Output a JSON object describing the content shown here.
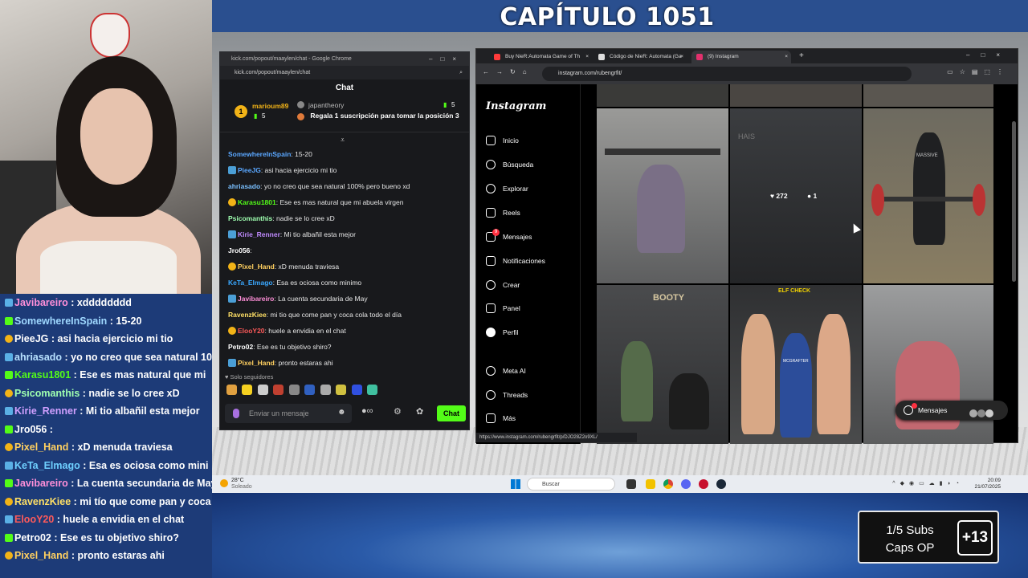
{
  "stream": {
    "chapter_title": "CAPÍTULO 1051",
    "chat_lines": [
      {
        "user": "Javibareiro",
        "text": " : xdddddddd",
        "color": "#ff8fd8"
      },
      {
        "user": "SomewhereInSpain",
        "text": " : 15-20",
        "color": "#9fd8ff"
      },
      {
        "user": "PieeJG",
        "text": " : asi hacia ejercicio mi tio",
        "color": "#ffffff"
      },
      {
        "user": "ahriasado",
        "text": " : yo no creo que sea natural 100% p",
        "color": "#b8e1ff"
      },
      {
        "user": "Karasu1801",
        "text": " : Ese es mas natural que mi",
        "color": "#53fc18"
      },
      {
        "user": "Psicomanthis",
        "text": " : nadie se lo cree xD",
        "color": "#9fffb0"
      },
      {
        "user": "Kirie_Renner",
        "text": " : Mi tio albañil esta mejor",
        "color": "#d0a0ff"
      },
      {
        "user": "Jro056",
        "text": " : ",
        "color": "#ffffff"
      },
      {
        "user": "Pixel_Hand",
        "text": " : xD menuda traviesa",
        "color": "#ffd060"
      },
      {
        "user": "KeTa_Elmago",
        "text": " : Esa es ociosa como mini",
        "color": "#6fd0ff"
      },
      {
        "user": "Javibareiro",
        "text": " : La cuenta secundaria de May",
        "color": "#ff8fd8"
      },
      {
        "user": "RavenzKiee",
        "text": " : mi tío que come pan y coca c",
        "color": "#ffe066"
      },
      {
        "user": "ElooY20",
        "text": " : huele a envidia en el chat",
        "color": "#ff5a5a"
      },
      {
        "user": "Petro02",
        "text": " : Ese es tu objetivo shiro?",
        "color": "#ffffff"
      },
      {
        "user": "Pixel_Hand",
        "text": " : pronto estaras ahi",
        "color": "#ffd060"
      }
    ]
  },
  "kick_window": {
    "title": "kick.com/popout/maaylen/chat - Google Chrome",
    "url": "kick.com/popout/maaylen/chat",
    "chat_header": "Chat",
    "pinned": {
      "top_gifter": "marioum89",
      "top_gifter_count": "5",
      "gifter2": "japantheory",
      "gifter2_count": "5",
      "gift_text": "Regala 1 suscripción para tomar la posición 3",
      "rank_badge": "1"
    },
    "messages": [
      {
        "user": "SomewhereInSpain",
        "text": ": 15-20",
        "color": "#5aa7ff"
      },
      {
        "user": "PieeJG",
        "text": ": asi hacia ejercicio mi tio",
        "color": "#5aa7ff"
      },
      {
        "user": "ahriasado",
        "text": ": yo no creo que sea natural 100% pero bueno xd",
        "color": "#7ac0ff"
      },
      {
        "user": "Karasu1801",
        "text": ": Ese es mas natural que mi abuela virgen",
        "color": "#53fc18"
      },
      {
        "user": "Psicomanthis",
        "text": ": nadie se lo cree xD",
        "color": "#9fffb0"
      },
      {
        "user": "Kirie_Renner",
        "text": ": Mi tio albañil esta mejor",
        "color": "#c08bff"
      },
      {
        "user": "Jro056",
        "text": ":",
        "color": "#ffffff"
      },
      {
        "user": "Pixel_Hand",
        "text": ": xD menuda traviesa",
        "color": "#ffd060"
      },
      {
        "user": "KeTa_Elmago",
        "text": ": Esa es ociosa como minimo",
        "color": "#3aa8ff"
      },
      {
        "user": "Javibareiro",
        "text": ": La cuenta secundaria de May",
        "color": "#ff8fd8"
      },
      {
        "user": "RavenzKiee",
        "text": ": mi tio que come pan y coca cola todo el día",
        "color": "#ffe066"
      },
      {
        "user": "ElooY20",
        "text": ": huele a envidia en el chat",
        "color": "#ff5a5a"
      },
      {
        "user": "Petro02",
        "text": ": Ese es tu objetivo shiro?",
        "color": "#ffffff"
      },
      {
        "user": "Pixel_Hand",
        "text": ": pronto estaras ahi",
        "color": "#ffd060"
      }
    ],
    "followers_only": "Solo seguidores",
    "input_placeholder": "Enviar un mensaje",
    "send_label": "Chat"
  },
  "browser": {
    "tabs": [
      {
        "label": "Buy NieR:Automata Game of Th",
        "color": "#ff3b3b"
      },
      {
        "label": "Código de NieR: Automata (Ga",
        "color": "#dddddd"
      },
      {
        "label": "(9) Instagram",
        "color": "#e1306c"
      }
    ],
    "url": "instagram.com/rubengrfit/",
    "status_url": "https://www.instagram.com/rubengrfit/p/DJO28Z2o9XL/"
  },
  "instagram": {
    "logo": "Instagram",
    "nav": [
      {
        "label": "Inicio",
        "icon": "home-icon"
      },
      {
        "label": "Búsqueda",
        "icon": "search-icon"
      },
      {
        "label": "Explorar",
        "icon": "compass-icon"
      },
      {
        "label": "Reels",
        "icon": "reels-icon"
      },
      {
        "label": "Mensajes",
        "icon": "messenger-icon",
        "badge": "9"
      },
      {
        "label": "Notificaciones",
        "icon": "heart-icon"
      },
      {
        "label": "Crear",
        "icon": "plus-icon"
      },
      {
        "label": "Panel",
        "icon": "chart-icon"
      },
      {
        "label": "Perfil",
        "icon": "avatar-icon"
      },
      {
        "label": "Meta AI",
        "icon": "meta-ai-icon"
      },
      {
        "label": "Threads",
        "icon": "threads-icon"
      },
      {
        "label": "Más",
        "icon": "menu-icon"
      }
    ],
    "hover_likes": "272",
    "hover_comments": "1",
    "messages_pill": "Mensajes",
    "post_labels": [
      "HAIS",
      "MASSIVE",
      "BOOTY",
      "ELF CHECK",
      "MCGRAFTER"
    ]
  },
  "taskbar": {
    "temperature": "28°C",
    "weather": "Soleado",
    "search_placeholder": "Buscar",
    "time": "20:09",
    "date": "21/07/2025"
  },
  "subs_widget": {
    "line1": "1/5 Subs",
    "line2": "Caps OP",
    "plus": "+13"
  }
}
